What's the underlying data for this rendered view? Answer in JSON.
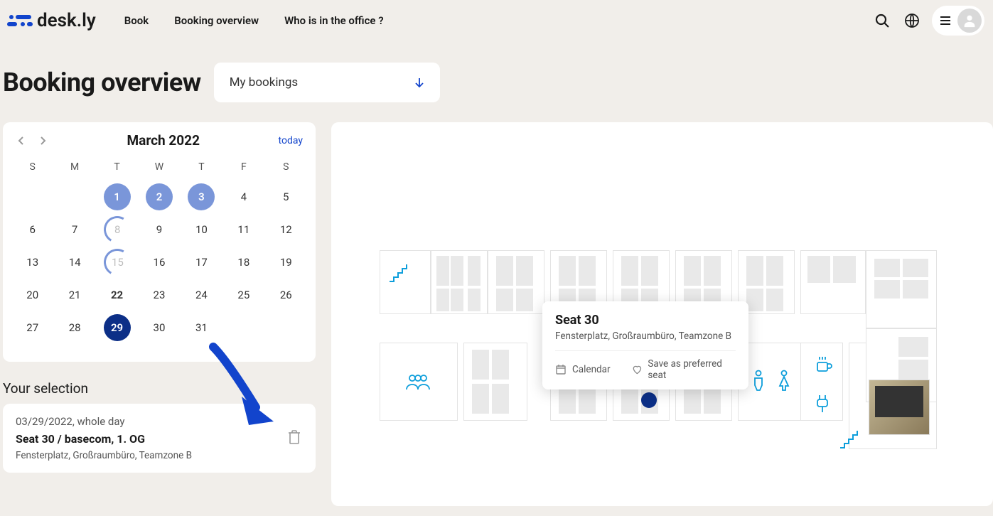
{
  "brand": {
    "name": "desk.ly"
  },
  "nav": {
    "book": "Book",
    "overview": "Booking overview",
    "who": "Who is in the office ?"
  },
  "page": {
    "title": "Booking overview"
  },
  "filter": {
    "label": "My bookings"
  },
  "calendar": {
    "title": "March 2022",
    "today": "today",
    "dow": [
      "S",
      "M",
      "T",
      "W",
      "T",
      "F",
      "S"
    ],
    "days": {
      "d1": "1",
      "d2": "2",
      "d3": "3",
      "d4": "4",
      "d5": "5",
      "d6": "6",
      "d7": "7",
      "d8": "8",
      "d9": "9",
      "d10": "10",
      "d11": "11",
      "d12": "12",
      "d13": "13",
      "d14": "14",
      "d15": "15",
      "d16": "16",
      "d17": "17",
      "d18": "18",
      "d19": "19",
      "d20": "20",
      "d21": "21",
      "d22": "22",
      "d23": "23",
      "d24": "24",
      "d25": "25",
      "d26": "26",
      "d27": "27",
      "d28": "28",
      "d29": "29",
      "d30": "30",
      "d31": "31"
    }
  },
  "selection": {
    "title": "Your selection",
    "date": "03/29/2022, whole day",
    "seat": "Seat 30 / basecom, 1. OG",
    "location": "Fensterplatz, Großraumbüro, Teamzone B"
  },
  "tooltip": {
    "title": "Seat 30",
    "subtitle": "Fensterplatz, Großraumbüro, Teamzone B",
    "calendar": "Calendar",
    "save": "Save as preferred seat"
  }
}
